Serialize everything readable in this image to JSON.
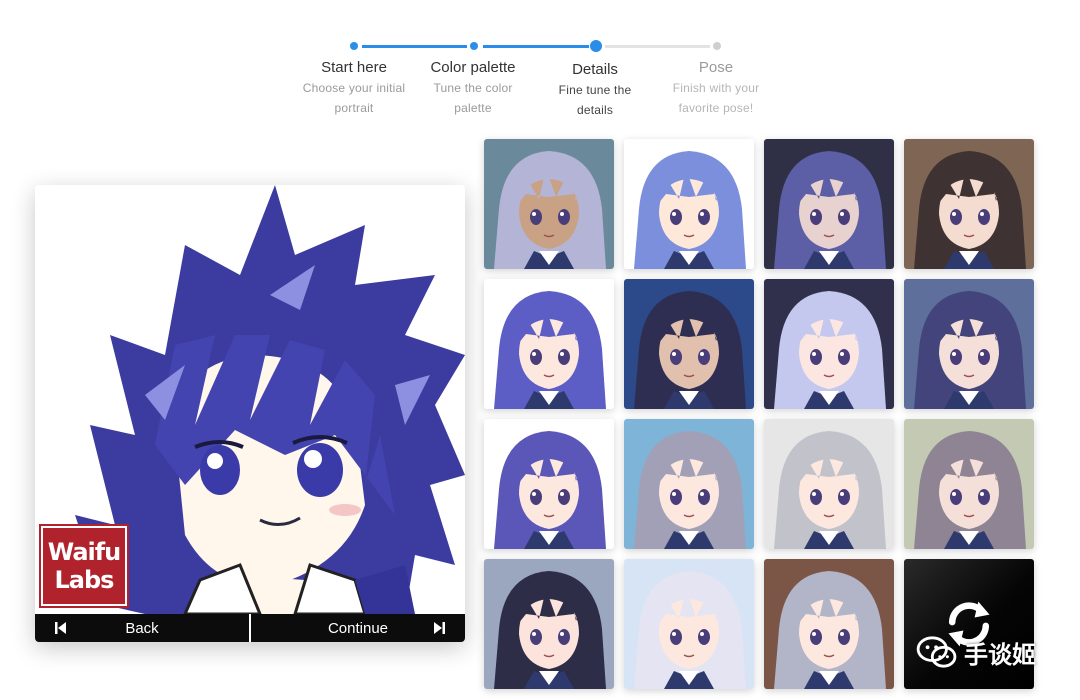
{
  "stepper": {
    "steps": [
      {
        "title": "Start here",
        "subtitle_line1": "Choose your initial",
        "subtitle_line2": "portrait",
        "state": "done"
      },
      {
        "title": "Color palette",
        "subtitle_line1": "Tune the color",
        "subtitle_line2": "palette",
        "state": "done"
      },
      {
        "title": "Details",
        "subtitle_line1": "Fine tune the",
        "subtitle_line2": "details",
        "state": "current"
      },
      {
        "title": "Pose",
        "subtitle_line1": "Finish with your",
        "subtitle_line2": "favorite pose!",
        "state": "future"
      }
    ],
    "accent_color": "#2a8ee8",
    "inactive_color": "#cfcfcf"
  },
  "card": {
    "logo_line1": "Waifu",
    "logo_line2": "Labs",
    "logo_color": "#b1232c",
    "back_label": "Back",
    "continue_label": "Continue",
    "back_icon": "skip-back-icon",
    "continue_icon": "skip-forward-icon"
  },
  "grid": {
    "tiles": [
      {
        "bg": "#6a8a9c",
        "hair": "#b4b5d6",
        "skin": "#c9a184"
      },
      {
        "bg": "#ffffff",
        "hair": "#7b8fdc",
        "skin": "#fde8da"
      },
      {
        "bg": "#2f3046",
        "hair": "#5c5ea6",
        "skin": "#e8d2cf"
      },
      {
        "bg": "#7f6554",
        "hair": "#3f3233",
        "skin": "#f4ddd0"
      },
      {
        "bg": "#ffffff",
        "hair": "#5c5ec6",
        "skin": "#fde8e0"
      },
      {
        "bg": "#2c4a8a",
        "hair": "#2e2e52",
        "skin": "#e2c0ae"
      },
      {
        "bg": "#30304c",
        "hair": "#c4c8ee",
        "skin": "#fbe6e2"
      },
      {
        "bg": "#5d6f9a",
        "hair": "#43447c",
        "skin": "#f4e0d8"
      },
      {
        "bg": "#ffffff",
        "hair": "#5a57b8",
        "skin": "#fde8e0"
      },
      {
        "bg": "#7eb4d8",
        "hair": "#a2a0b6",
        "skin": "#fde8e0"
      },
      {
        "bg": "#e6e6e6",
        "hair": "#c2c2ca",
        "skin": "#fde8e0"
      },
      {
        "bg": "#c4c9b4",
        "hair": "#8e8494",
        "skin": "#f4e0d8"
      },
      {
        "bg": "#9aa7be",
        "hair": "#2d2d48",
        "skin": "#fce4dc"
      },
      {
        "bg": "#d6e4f6",
        "hair": "#e4e4f2",
        "skin": "#fde8e0"
      },
      {
        "bg": "#7b5646",
        "hair": "#b2b4c8",
        "skin": "#fde8e0"
      }
    ],
    "refresh_icon": "refresh-icon"
  },
  "watermark": {
    "icon": "wechat-icon",
    "text": "手谈姬"
  }
}
